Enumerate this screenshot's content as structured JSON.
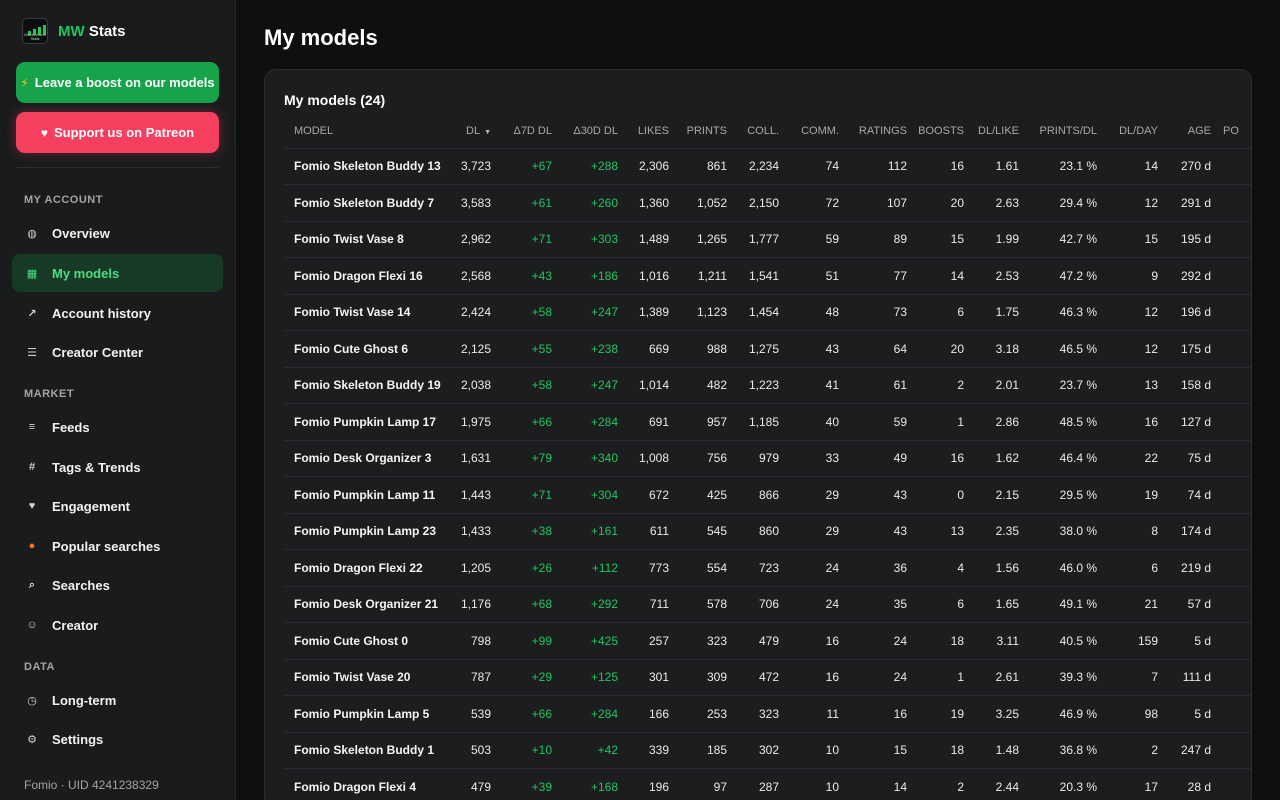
{
  "brand": {
    "prefix": "MW",
    "suffix": "Stats",
    "logo_text": "MakerWorld Stats"
  },
  "cta": {
    "boost_label": "Leave a boost on our models",
    "patreon_label": "Support us on Patreon"
  },
  "sections": {
    "account": "MY ACCOUNT",
    "market": "MARKET",
    "data": "DATA"
  },
  "nav": {
    "overview": "Overview",
    "my_models": "My models",
    "account_history": "Account history",
    "creator_center": "Creator Center",
    "feeds": "Feeds",
    "tags_trends": "Tags & Trends",
    "engagement": "Engagement",
    "popular_searches": "Popular searches",
    "searches": "Searches",
    "creator": "Creator",
    "long_term": "Long-term",
    "settings": "Settings"
  },
  "footer": "Fomio · UID 4241238329",
  "page_title": "My models",
  "card_title": "My models (24)",
  "accent": "#22c55e",
  "columns": [
    "MODEL",
    "DL",
    "Δ7D DL",
    "Δ30D DL",
    "LIKES",
    "PRINTS",
    "COLL.",
    "COMM.",
    "RATINGS",
    "BOOSTS",
    "DL/LIKE",
    "PRINTS/DL",
    "DL/DAY",
    "AGE",
    "PO"
  ],
  "rows": [
    [
      "Fomio Skeleton Buddy 13",
      "3,723",
      "+67",
      "+288",
      "2,306",
      "861",
      "2,234",
      "74",
      "112",
      "16",
      "1.61",
      "23.1 %",
      "14",
      "270 d"
    ],
    [
      "Fomio Skeleton Buddy 7",
      "3,583",
      "+61",
      "+260",
      "1,360",
      "1,052",
      "2,150",
      "72",
      "107",
      "20",
      "2.63",
      "29.4 %",
      "12",
      "291 d"
    ],
    [
      "Fomio Twist Vase 8",
      "2,962",
      "+71",
      "+303",
      "1,489",
      "1,265",
      "1,777",
      "59",
      "89",
      "15",
      "1.99",
      "42.7 %",
      "15",
      "195 d"
    ],
    [
      "Fomio Dragon Flexi 16",
      "2,568",
      "+43",
      "+186",
      "1,016",
      "1,211",
      "1,541",
      "51",
      "77",
      "14",
      "2.53",
      "47.2 %",
      "9",
      "292 d"
    ],
    [
      "Fomio Twist Vase 14",
      "2,424",
      "+58",
      "+247",
      "1,389",
      "1,123",
      "1,454",
      "48",
      "73",
      "6",
      "1.75",
      "46.3 %",
      "12",
      "196 d"
    ],
    [
      "Fomio Cute Ghost 6",
      "2,125",
      "+55",
      "+238",
      "669",
      "988",
      "1,275",
      "43",
      "64",
      "20",
      "3.18",
      "46.5 %",
      "12",
      "175 d"
    ],
    [
      "Fomio Skeleton Buddy 19",
      "2,038",
      "+58",
      "+247",
      "1,014",
      "482",
      "1,223",
      "41",
      "61",
      "2",
      "2.01",
      "23.7 %",
      "13",
      "158 d"
    ],
    [
      "Fomio Pumpkin Lamp 17",
      "1,975",
      "+66",
      "+284",
      "691",
      "957",
      "1,185",
      "40",
      "59",
      "1",
      "2.86",
      "48.5 %",
      "16",
      "127 d"
    ],
    [
      "Fomio Desk Organizer 3",
      "1,631",
      "+79",
      "+340",
      "1,008",
      "756",
      "979",
      "33",
      "49",
      "16",
      "1.62",
      "46.4 %",
      "22",
      "75 d"
    ],
    [
      "Fomio Pumpkin Lamp 11",
      "1,443",
      "+71",
      "+304",
      "672",
      "425",
      "866",
      "29",
      "43",
      "0",
      "2.15",
      "29.5 %",
      "19",
      "74 d"
    ],
    [
      "Fomio Pumpkin Lamp 23",
      "1,433",
      "+38",
      "+161",
      "611",
      "545",
      "860",
      "29",
      "43",
      "13",
      "2.35",
      "38.0 %",
      "8",
      "174 d"
    ],
    [
      "Fomio Dragon Flexi 22",
      "1,205",
      "+26",
      "+112",
      "773",
      "554",
      "723",
      "24",
      "36",
      "4",
      "1.56",
      "46.0 %",
      "6",
      "219 d"
    ],
    [
      "Fomio Desk Organizer 21",
      "1,176",
      "+68",
      "+292",
      "711",
      "578",
      "706",
      "24",
      "35",
      "6",
      "1.65",
      "49.1 %",
      "21",
      "57 d"
    ],
    [
      "Fomio Cute Ghost 0",
      "798",
      "+99",
      "+425",
      "257",
      "323",
      "479",
      "16",
      "24",
      "18",
      "3.11",
      "40.5 %",
      "159",
      "5 d"
    ],
    [
      "Fomio Twist Vase 20",
      "787",
      "+29",
      "+125",
      "301",
      "309",
      "472",
      "16",
      "24",
      "1",
      "2.61",
      "39.3 %",
      "7",
      "111 d"
    ],
    [
      "Fomio Pumpkin Lamp 5",
      "539",
      "+66",
      "+284",
      "166",
      "253",
      "323",
      "11",
      "16",
      "19",
      "3.25",
      "46.9 %",
      "98",
      "5 d"
    ],
    [
      "Fomio Skeleton Buddy 1",
      "503",
      "+10",
      "+42",
      "339",
      "185",
      "302",
      "10",
      "15",
      "18",
      "1.48",
      "36.8 %",
      "2",
      "247 d"
    ],
    [
      "Fomio Dragon Flexi 4",
      "479",
      "+39",
      "+168",
      "196",
      "97",
      "287",
      "10",
      "14",
      "2",
      "2.44",
      "20.3 %",
      "17",
      "28 d"
    ]
  ]
}
